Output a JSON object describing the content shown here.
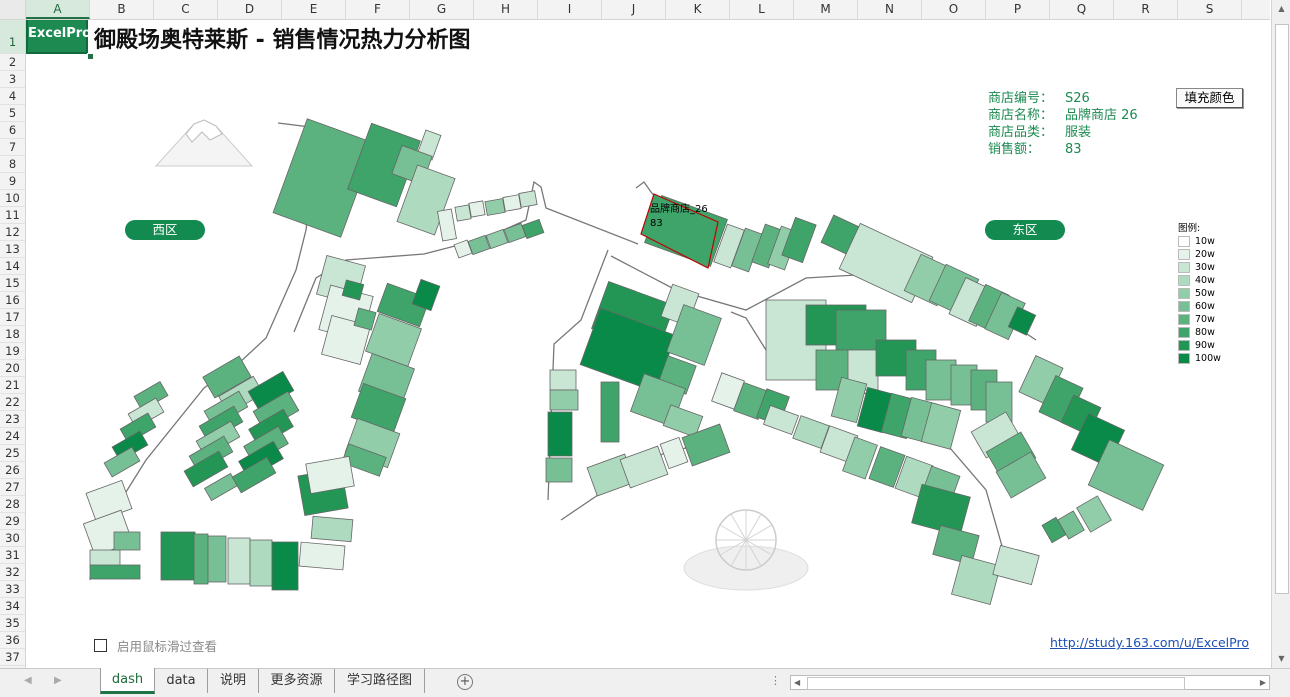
{
  "spreadsheet": {
    "columns": [
      "A",
      "B",
      "C",
      "D",
      "E",
      "F",
      "G",
      "H",
      "I",
      "J",
      "K",
      "L",
      "M",
      "N",
      "O",
      "P",
      "Q",
      "R",
      "S"
    ],
    "rows": [
      "1",
      "2",
      "3",
      "4",
      "5",
      "6",
      "7",
      "8",
      "9",
      "10",
      "11",
      "12",
      "13",
      "14",
      "15",
      "16",
      "17",
      "18",
      "19",
      "20",
      "21",
      "22",
      "23",
      "24",
      "25",
      "26",
      "27",
      "28",
      "29",
      "30",
      "31",
      "32",
      "33",
      "34",
      "35",
      "36",
      "37"
    ],
    "selected_cell": "A1"
  },
  "dashboard": {
    "logo": "ExcelPro",
    "title": "御殿场奥特莱斯 - 销售情况热力分析图",
    "west_label": "西区",
    "east_label": "东区",
    "fill_button": "填充颜色",
    "info": [
      {
        "key": "商店编号：",
        "value": "S26"
      },
      {
        "key": "商店名称：",
        "value": "品牌商店 26"
      },
      {
        "key": "商店品类：",
        "value": "服装"
      },
      {
        "key": "销售额：",
        "value": "83"
      }
    ],
    "tooltip": {
      "name": "品牌商店_26",
      "value": "83"
    },
    "legend_title": "图例:",
    "legend": [
      {
        "label": "10w",
        "color": "#ffffff"
      },
      {
        "label": "20w",
        "color": "#e4f2ea"
      },
      {
        "label": "30w",
        "color": "#c9e6d4"
      },
      {
        "label": "40w",
        "color": "#aedabf"
      },
      {
        "label": "50w",
        "color": "#92cdaa"
      },
      {
        "label": "60w",
        "color": "#77c095"
      },
      {
        "label": "70w",
        "color": "#5bb27f"
      },
      {
        "label": "80w",
        "color": "#3fa46a"
      },
      {
        "label": "90w",
        "color": "#239656"
      },
      {
        "label": "100w",
        "color": "#0a8a48"
      }
    ],
    "checkbox_label": "启用鼠标滑过查看",
    "link": "http://study.163.com/u/ExcelPro"
  },
  "sheet_tabs": [
    "dash",
    "data",
    "说明",
    "更多资源",
    "学习路径图"
  ],
  "active_tab": "dash",
  "colors": {
    "accent": "#217346",
    "brand": "#138a4f"
  }
}
